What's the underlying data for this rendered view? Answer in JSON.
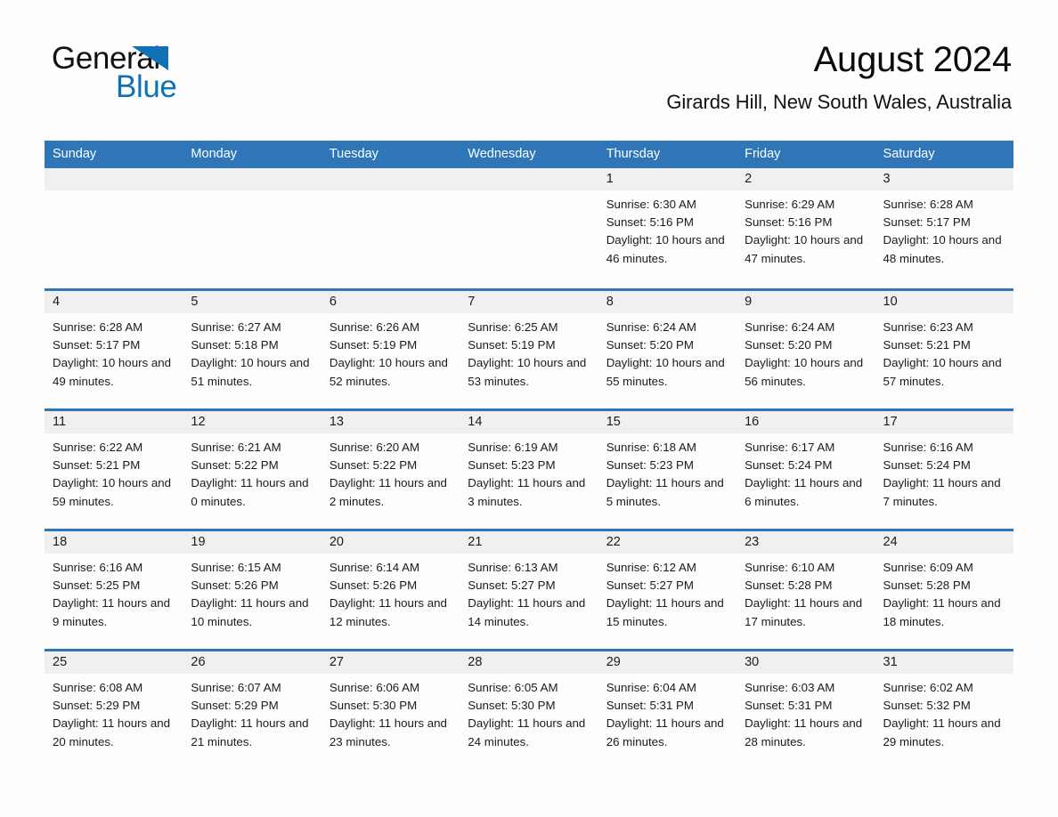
{
  "brand": {
    "word_one": "General",
    "word_two": "Blue",
    "accent_color": "#1271b5",
    "flag_icon": "triangle-flag-icon"
  },
  "header": {
    "title": "August 2024",
    "subtitle": "Girards Hill, New South Wales, Australia"
  },
  "calendar": {
    "header_bg": "#2f76b8",
    "weekdays": [
      "Sunday",
      "Monday",
      "Tuesday",
      "Wednesday",
      "Thursday",
      "Friday",
      "Saturday"
    ],
    "weeks": [
      [
        {
          "day": "",
          "empty": true
        },
        {
          "day": "",
          "empty": true
        },
        {
          "day": "",
          "empty": true
        },
        {
          "day": "",
          "empty": true
        },
        {
          "day": "1",
          "sunrise": "Sunrise: 6:30 AM",
          "sunset": "Sunset: 5:16 PM",
          "daylight": "Daylight: 10 hours and 46 minutes."
        },
        {
          "day": "2",
          "sunrise": "Sunrise: 6:29 AM",
          "sunset": "Sunset: 5:16 PM",
          "daylight": "Daylight: 10 hours and 47 minutes."
        },
        {
          "day": "3",
          "sunrise": "Sunrise: 6:28 AM",
          "sunset": "Sunset: 5:17 PM",
          "daylight": "Daylight: 10 hours and 48 minutes."
        }
      ],
      [
        {
          "day": "4",
          "sunrise": "Sunrise: 6:28 AM",
          "sunset": "Sunset: 5:17 PM",
          "daylight": "Daylight: 10 hours and 49 minutes."
        },
        {
          "day": "5",
          "sunrise": "Sunrise: 6:27 AM",
          "sunset": "Sunset: 5:18 PM",
          "daylight": "Daylight: 10 hours and 51 minutes."
        },
        {
          "day": "6",
          "sunrise": "Sunrise: 6:26 AM",
          "sunset": "Sunset: 5:19 PM",
          "daylight": "Daylight: 10 hours and 52 minutes."
        },
        {
          "day": "7",
          "sunrise": "Sunrise: 6:25 AM",
          "sunset": "Sunset: 5:19 PM",
          "daylight": "Daylight: 10 hours and 53 minutes."
        },
        {
          "day": "8",
          "sunrise": "Sunrise: 6:24 AM",
          "sunset": "Sunset: 5:20 PM",
          "daylight": "Daylight: 10 hours and 55 minutes."
        },
        {
          "day": "9",
          "sunrise": "Sunrise: 6:24 AM",
          "sunset": "Sunset: 5:20 PM",
          "daylight": "Daylight: 10 hours and 56 minutes."
        },
        {
          "day": "10",
          "sunrise": "Sunrise: 6:23 AM",
          "sunset": "Sunset: 5:21 PM",
          "daylight": "Daylight: 10 hours and 57 minutes."
        }
      ],
      [
        {
          "day": "11",
          "sunrise": "Sunrise: 6:22 AM",
          "sunset": "Sunset: 5:21 PM",
          "daylight": "Daylight: 10 hours and 59 minutes."
        },
        {
          "day": "12",
          "sunrise": "Sunrise: 6:21 AM",
          "sunset": "Sunset: 5:22 PM",
          "daylight": "Daylight: 11 hours and 0 minutes."
        },
        {
          "day": "13",
          "sunrise": "Sunrise: 6:20 AM",
          "sunset": "Sunset: 5:22 PM",
          "daylight": "Daylight: 11 hours and 2 minutes."
        },
        {
          "day": "14",
          "sunrise": "Sunrise: 6:19 AM",
          "sunset": "Sunset: 5:23 PM",
          "daylight": "Daylight: 11 hours and 3 minutes."
        },
        {
          "day": "15",
          "sunrise": "Sunrise: 6:18 AM",
          "sunset": "Sunset: 5:23 PM",
          "daylight": "Daylight: 11 hours and 5 minutes."
        },
        {
          "day": "16",
          "sunrise": "Sunrise: 6:17 AM",
          "sunset": "Sunset: 5:24 PM",
          "daylight": "Daylight: 11 hours and 6 minutes."
        },
        {
          "day": "17",
          "sunrise": "Sunrise: 6:16 AM",
          "sunset": "Sunset: 5:24 PM",
          "daylight": "Daylight: 11 hours and 7 minutes."
        }
      ],
      [
        {
          "day": "18",
          "sunrise": "Sunrise: 6:16 AM",
          "sunset": "Sunset: 5:25 PM",
          "daylight": "Daylight: 11 hours and 9 minutes."
        },
        {
          "day": "19",
          "sunrise": "Sunrise: 6:15 AM",
          "sunset": "Sunset: 5:26 PM",
          "daylight": "Daylight: 11 hours and 10 minutes."
        },
        {
          "day": "20",
          "sunrise": "Sunrise: 6:14 AM",
          "sunset": "Sunset: 5:26 PM",
          "daylight": "Daylight: 11 hours and 12 minutes."
        },
        {
          "day": "21",
          "sunrise": "Sunrise: 6:13 AM",
          "sunset": "Sunset: 5:27 PM",
          "daylight": "Daylight: 11 hours and 14 minutes."
        },
        {
          "day": "22",
          "sunrise": "Sunrise: 6:12 AM",
          "sunset": "Sunset: 5:27 PM",
          "daylight": "Daylight: 11 hours and 15 minutes."
        },
        {
          "day": "23",
          "sunrise": "Sunrise: 6:10 AM",
          "sunset": "Sunset: 5:28 PM",
          "daylight": "Daylight: 11 hours and 17 minutes."
        },
        {
          "day": "24",
          "sunrise": "Sunrise: 6:09 AM",
          "sunset": "Sunset: 5:28 PM",
          "daylight": "Daylight: 11 hours and 18 minutes."
        }
      ],
      [
        {
          "day": "25",
          "sunrise": "Sunrise: 6:08 AM",
          "sunset": "Sunset: 5:29 PM",
          "daylight": "Daylight: 11 hours and 20 minutes."
        },
        {
          "day": "26",
          "sunrise": "Sunrise: 6:07 AM",
          "sunset": "Sunset: 5:29 PM",
          "daylight": "Daylight: 11 hours and 21 minutes."
        },
        {
          "day": "27",
          "sunrise": "Sunrise: 6:06 AM",
          "sunset": "Sunset: 5:30 PM",
          "daylight": "Daylight: 11 hours and 23 minutes."
        },
        {
          "day": "28",
          "sunrise": "Sunrise: 6:05 AM",
          "sunset": "Sunset: 5:30 PM",
          "daylight": "Daylight: 11 hours and 24 minutes."
        },
        {
          "day": "29",
          "sunrise": "Sunrise: 6:04 AM",
          "sunset": "Sunset: 5:31 PM",
          "daylight": "Daylight: 11 hours and 26 minutes."
        },
        {
          "day": "30",
          "sunrise": "Sunrise: 6:03 AM",
          "sunset": "Sunset: 5:31 PM",
          "daylight": "Daylight: 11 hours and 28 minutes."
        },
        {
          "day": "31",
          "sunrise": "Sunrise: 6:02 AM",
          "sunset": "Sunset: 5:32 PM",
          "daylight": "Daylight: 11 hours and 29 minutes."
        }
      ]
    ]
  }
}
